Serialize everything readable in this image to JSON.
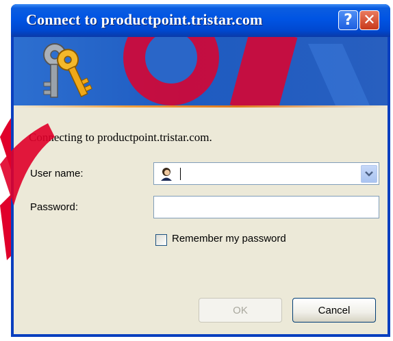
{
  "window": {
    "title": "Connect to productpoint.tristar.com"
  },
  "titlebar_buttons": {
    "help": "?",
    "close": "✕"
  },
  "dialog": {
    "connecting_text": "Connecting to productpoint.tristar.com.",
    "username_label": "User name:",
    "username_value": "",
    "password_label": "Password:",
    "password_value": "",
    "remember_label": "Remember my password",
    "remember_checked": false,
    "ok_label": "OK",
    "ok_enabled": false,
    "cancel_label": "Cancel"
  },
  "colors": {
    "titlebar": "#0054e3",
    "client_bg": "#ece9d8",
    "watermark": "#e0002a"
  },
  "icons": {
    "banner": "keys-icon",
    "user": "user-icon",
    "dropdown": "chevron-down-icon"
  }
}
